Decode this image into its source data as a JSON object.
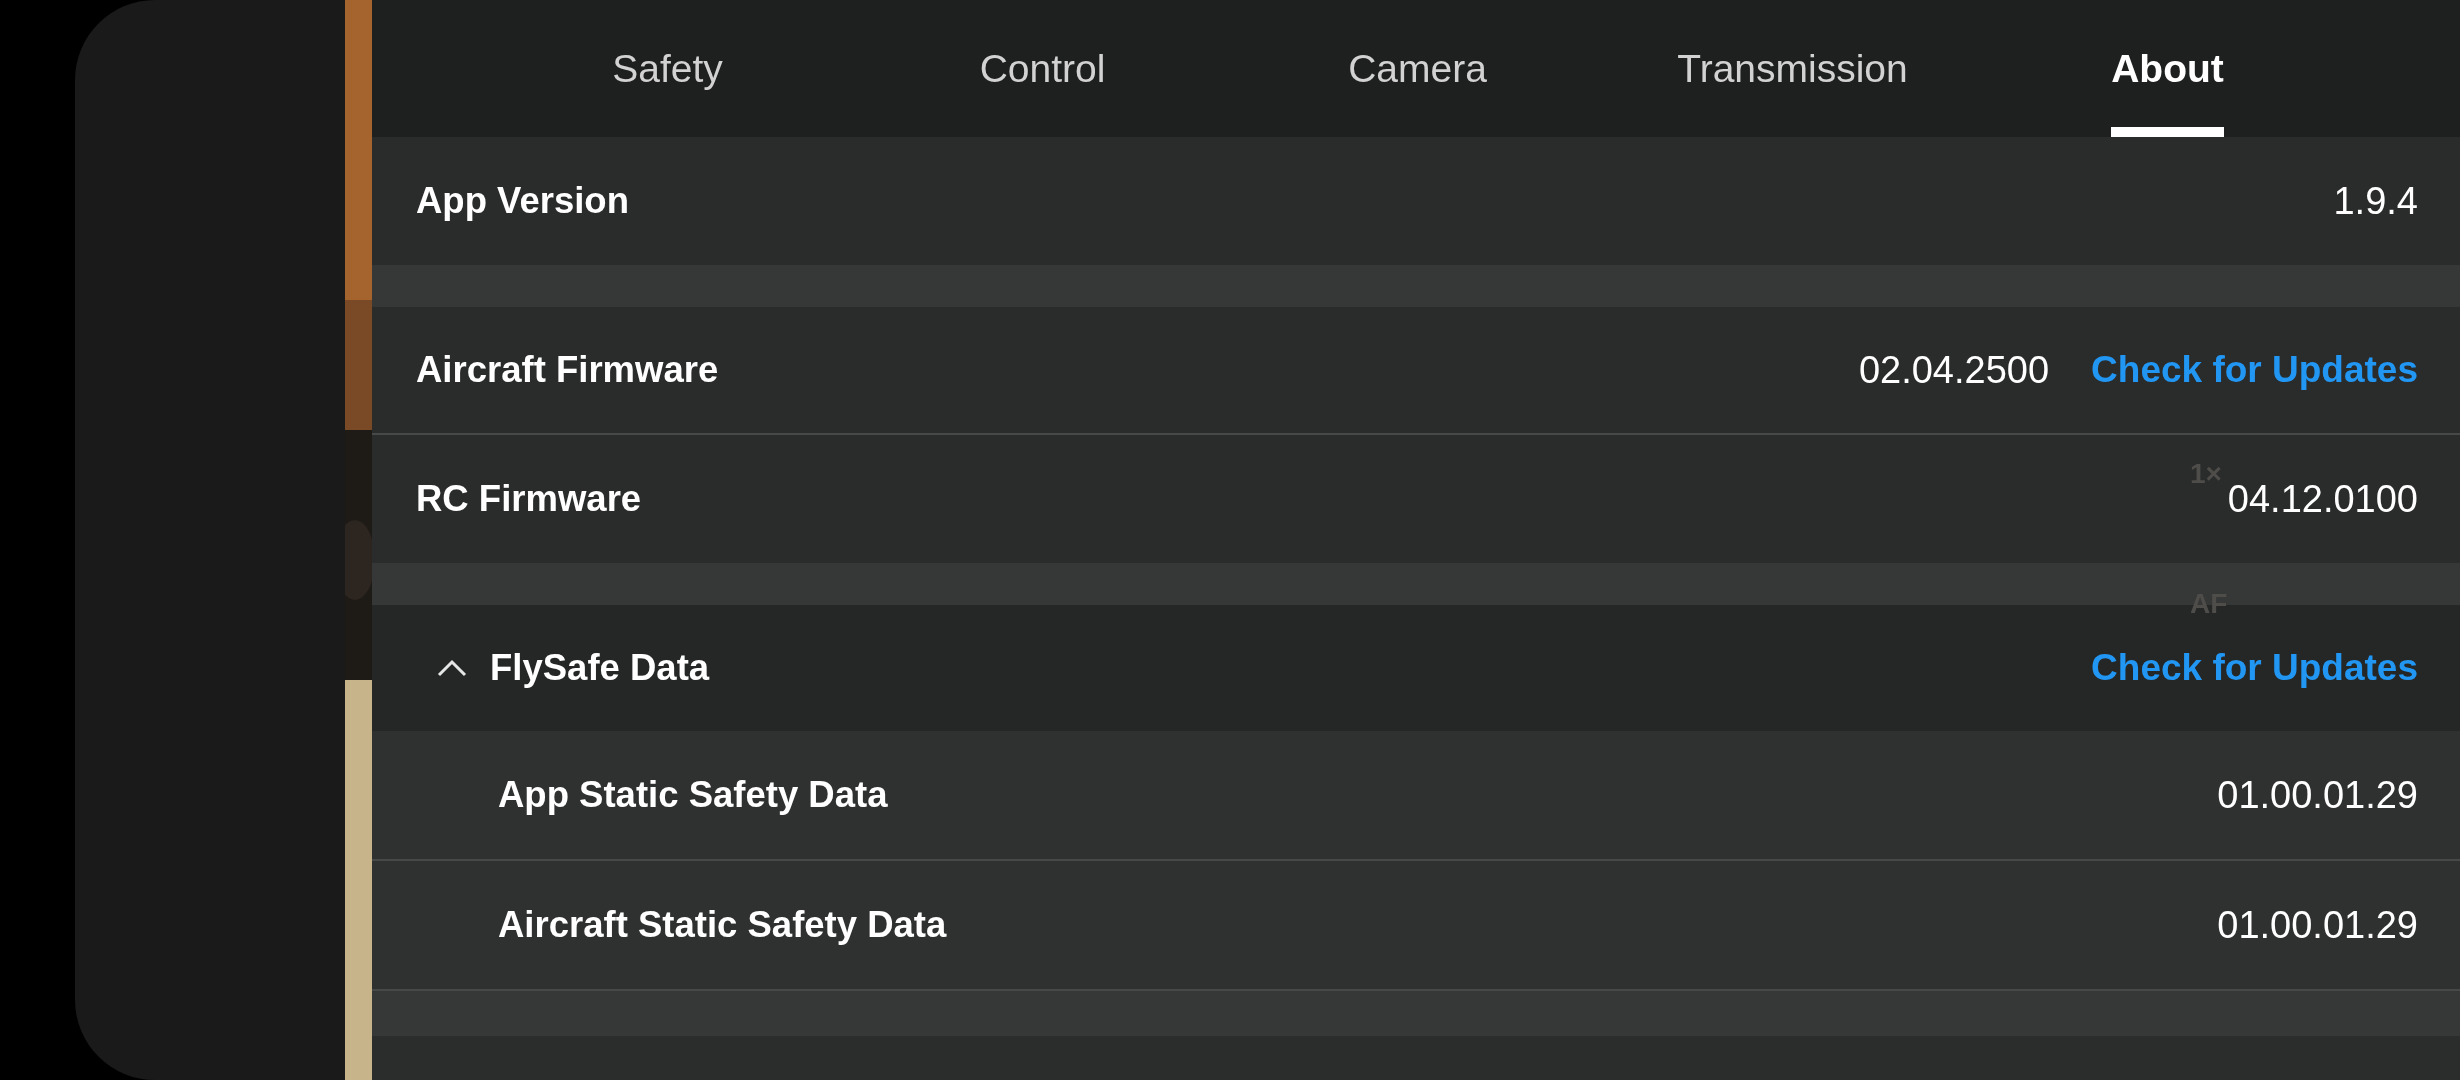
{
  "tabs": [
    {
      "label": "Safety",
      "selected": false
    },
    {
      "label": "Control",
      "selected": false
    },
    {
      "label": "Camera",
      "selected": false
    },
    {
      "label": "Transmission",
      "selected": false
    },
    {
      "label": "About",
      "selected": true
    }
  ],
  "sections": [
    {
      "rows": [
        {
          "label": "App Version",
          "value": "1.9.4"
        }
      ]
    },
    {
      "rows": [
        {
          "label": "Aircraft Firmware",
          "value": "02.04.2500",
          "action": "Check for Updates"
        },
        {
          "label": "RC Firmware",
          "value": "04.12.0100"
        }
      ]
    },
    {
      "rows": [
        {
          "label": "FlySafe Data",
          "expanded": true,
          "action": "Check for Updates",
          "children": [
            {
              "label": "App Static Safety Data",
              "value": "01.00.01.29"
            },
            {
              "label": "Aircraft Static Safety Data",
              "value": "01.00.01.29"
            }
          ]
        }
      ]
    }
  ],
  "camera_overlay": [
    "1×",
    "AF"
  ]
}
